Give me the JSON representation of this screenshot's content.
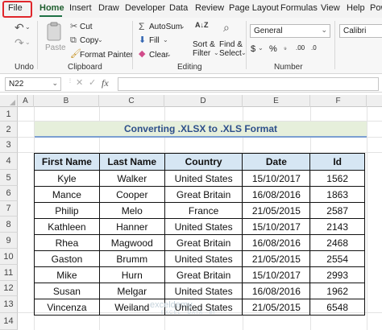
{
  "ribbon_tabs": [
    "File",
    "Home",
    "Insert",
    "Draw",
    "Developer",
    "Data",
    "Review",
    "Page Layout",
    "Formulas",
    "View",
    "Help",
    "Pow"
  ],
  "active_tab": "Home",
  "clipboard": {
    "paste_label": "Paste",
    "cut_label": "Cut",
    "copy_label": "Copy",
    "format_painter_label": "Format Painter",
    "group_label": "Clipboard"
  },
  "undo": {
    "group_label": "Undo"
  },
  "editing": {
    "autosum_label": "AutoSum",
    "fill_label": "Fill",
    "clear_label": "Clear",
    "sort_filter_line1": "Sort &",
    "sort_filter_line2": "Filter",
    "find_select_line1": "Find &",
    "find_select_line2": "Select",
    "group_label": "Editing"
  },
  "number": {
    "format_value": "General",
    "group_label": "Number",
    "currency_symbol": "$",
    "percent_symbol": "%",
    "decimal_inc": ".00",
    "decimal_dec": ".0"
  },
  "font": {
    "font_value": "Calibri"
  },
  "formula_bar": {
    "namebox_value": "N22",
    "fx_label": "fx",
    "formula_value": ""
  },
  "columns": [
    "A",
    "B",
    "C",
    "D",
    "E",
    "F"
  ],
  "rows": [
    "1",
    "2",
    "3",
    "4",
    "5",
    "6",
    "7",
    "8",
    "9",
    "10",
    "11",
    "12",
    "13",
    "14"
  ],
  "title": "Converting .XLSX to .XLS Format",
  "table": {
    "headers": [
      "First Name",
      "Last Name",
      "Country",
      "Date",
      "Id"
    ],
    "rows": [
      [
        "Kyle",
        "Walker",
        "United States",
        "15/10/2017",
        "1562"
      ],
      [
        "Mance",
        "Cooper",
        "Great Britain",
        "16/08/2016",
        "1863"
      ],
      [
        "Philip",
        "Melo",
        "France",
        "21/05/2015",
        "2587"
      ],
      [
        "Kathleen",
        "Hanner",
        "United States",
        "15/10/2017",
        "2143"
      ],
      [
        "Rhea",
        "Magwood",
        "Great Britain",
        "16/08/2016",
        "2468"
      ],
      [
        "Gaston",
        "Brumm",
        "United States",
        "21/05/2015",
        "2554"
      ],
      [
        "Mike",
        "Hurn",
        "Great Britain",
        "15/10/2017",
        "2993"
      ],
      [
        "Susan",
        "Melgar",
        "United States",
        "16/08/2016",
        "1962"
      ],
      [
        "Vincenza",
        "Weiland",
        "United States",
        "21/05/2015",
        "6548"
      ]
    ]
  },
  "watermark": {
    "brand": "exceldemy",
    "tagline": "EXCEL · DATA · BI"
  },
  "colors": {
    "accent_green": "#1e7145",
    "file_highlight": "#e0262b",
    "title_fill": "#e6efdb",
    "title_text": "#2d4f8a",
    "header_fill": "#d6e6f3"
  }
}
